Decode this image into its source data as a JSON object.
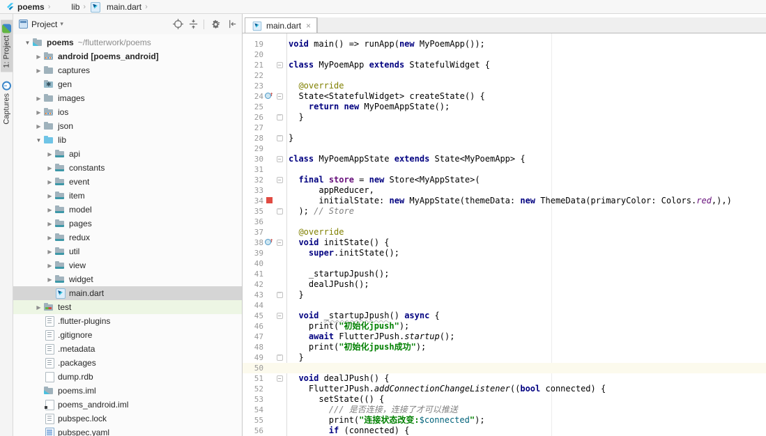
{
  "breadcrumb": {
    "items": [
      {
        "icon": "flutter-icon",
        "label": "poems",
        "bold": true
      },
      {
        "icon": "folder-icon",
        "label": "lib",
        "bold": false
      },
      {
        "icon": "dart-file-icon",
        "label": "main.dart",
        "bold": false
      }
    ]
  },
  "left_stripe": {
    "tabs": [
      {
        "label": "1: Project",
        "icon": "project-toolwindow-icon",
        "active": true
      },
      {
        "label": "Captures",
        "icon": "captures-toolwindow-icon",
        "active": false
      }
    ]
  },
  "project_panel": {
    "title": "Project",
    "actions": [
      "locate-icon",
      "collapse-all-icon",
      "settings-gear-icon",
      "hide-panel-icon"
    ],
    "tree": [
      {
        "depth": 0,
        "arrow": "down",
        "icon": "flutter-folder",
        "label": "poems",
        "bold": true,
        "annex": "~/flutterwork/poems"
      },
      {
        "depth": 1,
        "arrow": "right",
        "icon": "module-folder",
        "label": "android [poems_android]",
        "bold": true
      },
      {
        "depth": 1,
        "arrow": "right",
        "icon": "folder",
        "label": "captures"
      },
      {
        "depth": 1,
        "arrow": "none",
        "icon": "gen-folder",
        "label": "gen"
      },
      {
        "depth": 1,
        "arrow": "right",
        "icon": "folder",
        "label": "images"
      },
      {
        "depth": 1,
        "arrow": "right",
        "icon": "module-folder",
        "label": "ios"
      },
      {
        "depth": 1,
        "arrow": "right",
        "icon": "folder",
        "label": "json"
      },
      {
        "depth": 1,
        "arrow": "down",
        "icon": "src-folder",
        "label": "lib"
      },
      {
        "depth": 2,
        "arrow": "right",
        "icon": "pkg-folder",
        "label": "api"
      },
      {
        "depth": 2,
        "arrow": "right",
        "icon": "pkg-folder",
        "label": "constants"
      },
      {
        "depth": 2,
        "arrow": "right",
        "icon": "pkg-folder",
        "label": "event"
      },
      {
        "depth": 2,
        "arrow": "right",
        "icon": "pkg-folder",
        "label": "item"
      },
      {
        "depth": 2,
        "arrow": "right",
        "icon": "pkg-folder",
        "label": "model"
      },
      {
        "depth": 2,
        "arrow": "right",
        "icon": "pkg-folder",
        "label": "pages"
      },
      {
        "depth": 2,
        "arrow": "right",
        "icon": "pkg-folder",
        "label": "redux"
      },
      {
        "depth": 2,
        "arrow": "right",
        "icon": "pkg-folder",
        "label": "util"
      },
      {
        "depth": 2,
        "arrow": "right",
        "icon": "pkg-folder",
        "label": "view"
      },
      {
        "depth": 2,
        "arrow": "right",
        "icon": "pkg-folder",
        "label": "widget"
      },
      {
        "depth": 2,
        "arrow": "none",
        "icon": "dart-file",
        "label": "main.dart",
        "selected": true
      },
      {
        "depth": 1,
        "arrow": "right",
        "icon": "test-folder",
        "label": "test",
        "testbg": true
      },
      {
        "depth": 1,
        "arrow": "none",
        "icon": "text-file",
        "label": ".flutter-plugins"
      },
      {
        "depth": 1,
        "arrow": "none",
        "icon": "text-file",
        "label": ".gitignore"
      },
      {
        "depth": 1,
        "arrow": "none",
        "icon": "text-file",
        "label": ".metadata"
      },
      {
        "depth": 1,
        "arrow": "none",
        "icon": "text-file",
        "label": ".packages"
      },
      {
        "depth": 1,
        "arrow": "none",
        "icon": "plain-file",
        "label": "dump.rdb"
      },
      {
        "depth": 1,
        "arrow": "none",
        "icon": "flutter-folder",
        "label": "poems.iml"
      },
      {
        "depth": 1,
        "arrow": "none",
        "icon": "iml-module",
        "label": "poems_android.iml"
      },
      {
        "depth": 1,
        "arrow": "none",
        "icon": "text-file",
        "label": "pubspec.lock"
      },
      {
        "depth": 1,
        "arrow": "none",
        "icon": "yaml-file",
        "label": "pubspec.yaml"
      }
    ]
  },
  "editor": {
    "tab": {
      "label": "main.dart",
      "icon": "dart-file-icon",
      "close": "×"
    },
    "lines": [
      {
        "num": 19,
        "tokens": [
          [
            "k",
            "void"
          ],
          [
            "t",
            " main() => runApp("
          ],
          [
            "k",
            "new"
          ],
          [
            "t",
            " MyPoemApp());"
          ]
        ]
      },
      {
        "num": 20,
        "tokens": []
      },
      {
        "num": 21,
        "fold": "start",
        "tokens": [
          [
            "k",
            "class"
          ],
          [
            "t",
            " MyPoemApp "
          ],
          [
            "k",
            "extends"
          ],
          [
            "t",
            " StatefulWidget {"
          ]
        ]
      },
      {
        "num": 22,
        "tokens": []
      },
      {
        "num": 23,
        "tokens": [
          [
            "t",
            "  "
          ],
          [
            "an",
            "@override"
          ]
        ]
      },
      {
        "num": 24,
        "marker": "override",
        "fold": "start",
        "tokens": [
          [
            "t",
            "  State<StatefulWidget> createState() {"
          ]
        ]
      },
      {
        "num": 25,
        "tokens": [
          [
            "t",
            "    "
          ],
          [
            "k",
            "return"
          ],
          [
            "t",
            " "
          ],
          [
            "k",
            "new"
          ],
          [
            "t",
            " MyPoemAppState();"
          ]
        ]
      },
      {
        "num": 26,
        "fold": "end",
        "tokens": [
          [
            "t",
            "  }"
          ]
        ]
      },
      {
        "num": 27,
        "tokens": []
      },
      {
        "num": 28,
        "fold": "end",
        "tokens": [
          [
            "t",
            "}"
          ]
        ]
      },
      {
        "num": 29,
        "tokens": []
      },
      {
        "num": 30,
        "fold": "start",
        "tokens": [
          [
            "k",
            "class"
          ],
          [
            "t",
            " MyPoemAppState "
          ],
          [
            "k",
            "extends"
          ],
          [
            "t",
            " State<MyPoemApp> {"
          ]
        ]
      },
      {
        "num": 31,
        "tokens": []
      },
      {
        "num": 32,
        "fold": "start",
        "tokens": [
          [
            "t",
            "  "
          ],
          [
            "k",
            "final"
          ],
          [
            "t",
            " "
          ],
          [
            "fld",
            "store"
          ],
          [
            "t",
            " = "
          ],
          [
            "k",
            "new"
          ],
          [
            "t",
            " Store<MyAppState>("
          ]
        ]
      },
      {
        "num": 33,
        "tokens": [
          [
            "t",
            "      appReducer,"
          ]
        ]
      },
      {
        "num": 34,
        "marker": "color-red",
        "tokens": [
          [
            "t",
            "      initialState: "
          ],
          [
            "k",
            "new"
          ],
          [
            "t",
            " MyAppState(themeData: "
          ],
          [
            "k",
            "new"
          ],
          [
            "t",
            " ThemeData(primaryColor: Colors."
          ],
          [
            "sti",
            "red"
          ],
          [
            "t",
            ",),)"
          ]
        ]
      },
      {
        "num": 35,
        "fold": "end",
        "tokens": [
          [
            "t",
            "  ); "
          ],
          [
            "c",
            "// Store"
          ]
        ]
      },
      {
        "num": 36,
        "tokens": []
      },
      {
        "num": 37,
        "tokens": [
          [
            "t",
            "  "
          ],
          [
            "an",
            "@override"
          ]
        ]
      },
      {
        "num": 38,
        "marker": "override",
        "fold": "start",
        "tokens": [
          [
            "t",
            "  "
          ],
          [
            "k",
            "void"
          ],
          [
            "t",
            " initState() {"
          ]
        ]
      },
      {
        "num": 39,
        "tokens": [
          [
            "t",
            "    "
          ],
          [
            "k",
            "super"
          ],
          [
            "t",
            ".initState();"
          ]
        ]
      },
      {
        "num": 40,
        "tokens": []
      },
      {
        "num": 41,
        "tokens": [
          [
            "t",
            "    _startupJpush();"
          ]
        ]
      },
      {
        "num": 42,
        "tokens": [
          [
            "t",
            "    dealJPush();"
          ]
        ]
      },
      {
        "num": 43,
        "fold": "end",
        "tokens": [
          [
            "t",
            "  }"
          ]
        ]
      },
      {
        "num": 44,
        "tokens": []
      },
      {
        "num": 45,
        "fold": "start",
        "tokens": [
          [
            "t",
            "  "
          ],
          [
            "k",
            "void"
          ],
          [
            "t",
            " "
          ],
          [
            "u",
            "_startupJpush"
          ],
          [
            "t",
            "() "
          ],
          [
            "k",
            "async"
          ],
          [
            "t",
            " {"
          ]
        ]
      },
      {
        "num": 46,
        "tokens": [
          [
            "t",
            "    print("
          ],
          [
            "s",
            "\"初始化jpush\""
          ],
          [
            "t",
            ");"
          ]
        ]
      },
      {
        "num": 47,
        "tokens": [
          [
            "t",
            "    "
          ],
          [
            "k",
            "await"
          ],
          [
            "t",
            " FlutterJPush."
          ],
          [
            "mi",
            "startup"
          ],
          [
            "t",
            "();"
          ]
        ]
      },
      {
        "num": 48,
        "tokens": [
          [
            "t",
            "    print("
          ],
          [
            "s",
            "\"初始化jpush成功\""
          ],
          [
            "t",
            ");"
          ]
        ]
      },
      {
        "num": 49,
        "fold": "end",
        "tokens": [
          [
            "t",
            "  }"
          ]
        ]
      },
      {
        "num": 50,
        "caret": true,
        "tokens": []
      },
      {
        "num": 51,
        "fold": "start",
        "tokens": [
          [
            "t",
            "  "
          ],
          [
            "k",
            "void"
          ],
          [
            "t",
            " dealJPush() {"
          ]
        ]
      },
      {
        "num": 52,
        "tokens": [
          [
            "t",
            "    FlutterJPush."
          ],
          [
            "mi",
            "addConnectionChangeListener"
          ],
          [
            "t",
            "(("
          ],
          [
            "k",
            "bool"
          ],
          [
            "t",
            " connected) {"
          ]
        ]
      },
      {
        "num": 53,
        "tokens": [
          [
            "t",
            "      setState(() {"
          ]
        ]
      },
      {
        "num": 54,
        "tokens": [
          [
            "t",
            "        "
          ],
          [
            "dc",
            "/// 是否连接，连接了才可以推送"
          ]
        ]
      },
      {
        "num": 55,
        "tokens": [
          [
            "t",
            "        print("
          ],
          [
            "s",
            "\"连接状态改变:"
          ],
          [
            "si",
            "$connected"
          ],
          [
            "s",
            "\""
          ],
          [
            "t",
            ");"
          ]
        ]
      },
      {
        "num": 56,
        "tokens": [
          [
            "t",
            "        "
          ],
          [
            "k",
            "if"
          ],
          [
            "t",
            " (connected) {"
          ]
        ]
      }
    ]
  }
}
